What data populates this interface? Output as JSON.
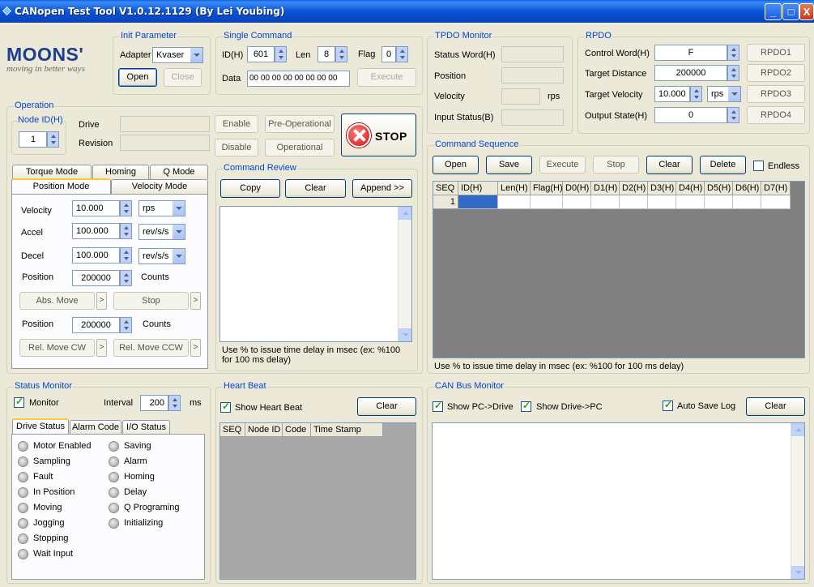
{
  "window": {
    "title": "CANopen Test Tool V1.0.12.1129 (By Lei Youbing)",
    "min": "_",
    "max": "□",
    "close": "X"
  },
  "logo": {
    "brand": "MOONS'",
    "tagline": "moving in better ways"
  },
  "init": {
    "group": "Init Parameter",
    "adapter_label": "Adapter",
    "adapter_value": "Kvaser",
    "open": "Open",
    "close": "Close"
  },
  "single": {
    "group": "Single Command",
    "id_label": "ID(H)",
    "id_value": "601",
    "len_label": "Len",
    "len_value": "8",
    "flag_label": "Flag",
    "flag_value": "0",
    "data_label": "Data",
    "data_value": "00 00 00 00 00 00 00 00",
    "execute": "Execute"
  },
  "tpdo": {
    "group": "TPDO Monitor",
    "status_word": "Status Word(H)",
    "position": "Position",
    "velocity": "Velocity",
    "velocity_unit": "rps",
    "input_status": "Input Status(B)"
  },
  "rpdo": {
    "group": "RPDO",
    "control_word": "Control Word(H)",
    "control_word_value": "F",
    "target_distance": "Target Distance",
    "target_distance_value": "200000",
    "target_velocity": "Target Velocity",
    "target_velocity_value": "10.000",
    "target_velocity_unit": "rps",
    "output_state": "Output State(H)",
    "output_state_value": "0",
    "rpdo1": "RPDO1",
    "rpdo2": "RPDO2",
    "rpdo3": "RPDO3",
    "rpdo4": "RPDO4"
  },
  "operation": {
    "group": "Operation",
    "node_group": "Node ID(H)",
    "node_value": "1",
    "drive": "Drive",
    "revision": "Revision",
    "enable": "Enable",
    "disable": "Disable",
    "preop": "Pre-Operational",
    "operational": "Operational",
    "stop": "STOP"
  },
  "modes": {
    "tabs": [
      "Torque Mode",
      "Homing",
      "Q Mode",
      "Position Mode",
      "Velocity Mode"
    ],
    "velocity": "Velocity",
    "velocity_value": "10.000",
    "velocity_unit": "rps",
    "accel": "Accel",
    "accel_value": "100.000",
    "accel_unit": "rev/s/s",
    "decel": "Decel",
    "decel_value": "100.000",
    "decel_unit": "rev/s/s",
    "position1": "Position",
    "position1_value": "200000",
    "counts1": "Counts",
    "abs_move": "Abs. Move",
    "stop": "Stop",
    "arrow": ">",
    "position2": "Position",
    "position2_value": "200000",
    "counts2": "Counts",
    "rel_cw": "Rel. Move CW",
    "rel_ccw": "Rel. Move CCW"
  },
  "review": {
    "group": "Command Review",
    "copy": "Copy",
    "clear": "Clear",
    "append": "Append >>",
    "hint": "Use % to issue time delay in msec (ex: %100 for 100 ms delay)"
  },
  "sequence": {
    "group": "Command Sequence",
    "open": "Open",
    "save": "Save",
    "execute": "Execute",
    "stop": "Stop",
    "clear": "Clear",
    "delete": "Delete",
    "endless": "Endless",
    "columns": [
      "SEQ",
      "ID(H)",
      "Len(H)",
      "Flag(H)",
      "D0(H)",
      "D1(H)",
      "D2(H)",
      "D3(H)",
      "D4(H)",
      "D5(H)",
      "D6(H)",
      "D7(H)"
    ],
    "rows": [
      [
        "1",
        "",
        "",
        "",
        "",
        "",
        "",
        "",
        "",
        "",
        "",
        ""
      ]
    ],
    "hint": "Use % to issue time delay in msec (ex: %100 for 100 ms delay)"
  },
  "status": {
    "group": "Status Monitor",
    "monitor": "Monitor",
    "interval": "Interval",
    "interval_value": "200",
    "ms": "ms",
    "tabs": [
      "Drive Status",
      "Alarm Code",
      "I/O Status"
    ],
    "left": [
      "Motor Enabled",
      "Sampling",
      "Fault",
      "In Position",
      "Moving",
      "Jogging",
      "Stopping",
      "Wait Input"
    ],
    "right": [
      "Saving",
      "Alarm",
      "Homing",
      "Delay",
      "Q Programing",
      "Initializing"
    ]
  },
  "heartbeat": {
    "group": "Heart Beat",
    "show": "Show Heart Beat",
    "clear": "Clear",
    "columns": [
      "SEQ",
      "Node ID",
      "Code",
      "Time Stamp"
    ]
  },
  "canbus": {
    "group": "CAN Bus Monitor",
    "pc_drive": "Show PC->Drive",
    "drive_pc": "Show Drive->PC",
    "autosave": "Auto Save Log",
    "clear": "Clear"
  }
}
